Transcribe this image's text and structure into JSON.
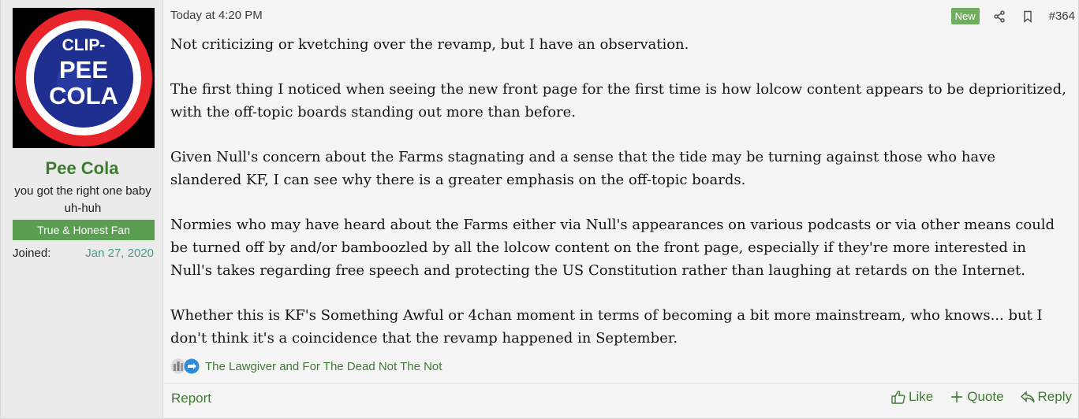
{
  "user": {
    "avatar_lines": [
      "CLIP-",
      "PEE",
      "COLA"
    ],
    "name": "Pee Cola",
    "title": "you got the right one baby uh-huh",
    "banner": "True & Honest Fan",
    "joined_label": "Joined:",
    "joined_value": "Jan 27, 2020"
  },
  "header": {
    "timestamp": "Today at 4:20 PM",
    "new_badge": "New",
    "post_number": "#364",
    "icons": [
      "share-icon",
      "bookmark-icon"
    ]
  },
  "body": {
    "paragraphs": [
      "Not criticizing or kvetching over the revamp, but I have an observation.",
      "The first thing I noticed when seeing the new front page for the first time is how lolcow content appears to be deprioritized, with the off-topic boards standing out more than before.",
      "Given Null's concern about the Farms stagnating and a sense that the tide may be turning against those who have slandered KF, I can see why there is a greater emphasis on the off-topic boards.",
      "Normies who may have heard about the Farms either via Null's appearances on various podcasts or via other means could be turned off by and/or bamboozled by all the lolcow content on the front page, especially if they're more interested in Null's takes regarding free speech and protecting the US Constitution rather than laughing at retards on the Internet.",
      "Whether this is KF's Something Awful or 4chan moment in terms of becoming a bit more mainstream, who knows... but I don't think it's a coincidence that the revamp happened in September."
    ]
  },
  "reactions": {
    "icons": [
      "informative-reaction-icon",
      "agree-reaction-icon"
    ],
    "text": "The Lawgiver and For The Dead Not The Not"
  },
  "footer": {
    "report": "Report",
    "like": "Like",
    "quote": "Quote",
    "reply": "Reply"
  },
  "colors": {
    "accent_green": "#3f7a33",
    "banner_green": "#5a9e52",
    "badge_green": "#6fae5f",
    "joined_teal": "#4a9a8a"
  }
}
